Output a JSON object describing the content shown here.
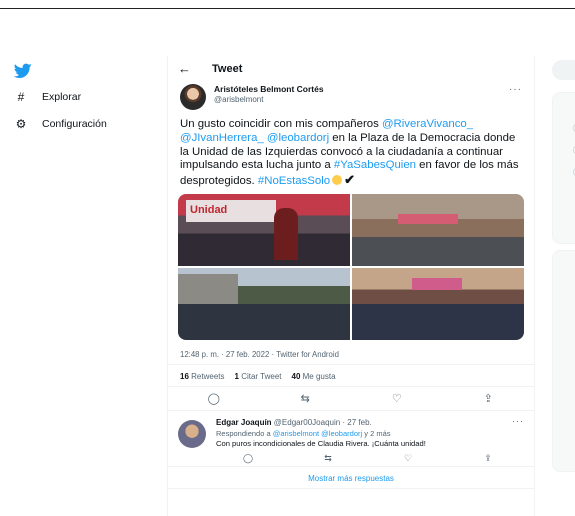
{
  "sidebar": {
    "logo_icon": "twitter-bird-icon",
    "items": [
      {
        "label": "Explorar",
        "icon": "hashtag-icon"
      },
      {
        "label": "Configuración",
        "icon": "gear-icon"
      }
    ]
  },
  "header": {
    "title": "Tweet",
    "back_icon": "arrow-left-icon"
  },
  "tweet": {
    "author_name": "Aristóteles Belmont Cortés",
    "author_handle": "@arisbelmont",
    "text_parts": [
      "Un gusto coincidir con mis compañeros ",
      "@RiveraVivanco_",
      " ",
      "@JIvanHerrera_",
      " ",
      "@leobardorj",
      " en la Plaza de la Democracia donde la Unidad de las Izquierdas convocó a la ciudadanía a continuar impulsando esta lucha junto a ",
      "#YaSabesQuien",
      " en favor de los más desprotegidos. ",
      "#NoEstasSolo",
      "✔"
    ],
    "photo_banner_text": "Unidad",
    "meta": "12:48 p. m. · 27 feb. 2022 · Twitter for Android",
    "stats": [
      {
        "count": "16",
        "label": "Retweets"
      },
      {
        "count": "1",
        "label": "Citar Tweet"
      },
      {
        "count": "40",
        "label": "Me gusta"
      }
    ]
  },
  "reply": {
    "name": "Edgar Joaquín",
    "handle_time": "@Edgar00Joaquin · 27 feb.",
    "replying_prefix": "Respondiendo a ",
    "replying_handles": "@arisbelmont @leobardorj",
    "replying_suffix": " y 2 más",
    "text": "Con puros incondicionales de Claudia Rivera.  ¡Cuánta unidad!"
  },
  "show_more": "Mostrar más respuestas",
  "colors": {
    "accent": "#1d9bf0",
    "text": "#0f1419",
    "muted": "#536471"
  }
}
